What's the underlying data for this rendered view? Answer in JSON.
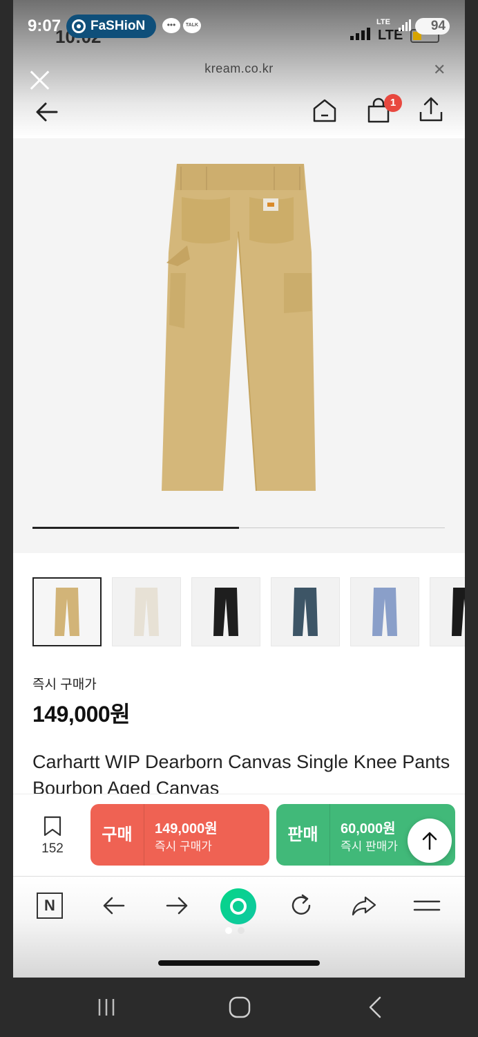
{
  "status_bar": {
    "time": "9:07",
    "ghost_time": "10:02",
    "app_pill_label": "FaSHioN",
    "talk_label": "TALK",
    "network": "LTE",
    "network_small": "LTE",
    "battery": "94"
  },
  "browser": {
    "url": "kream.co.kr",
    "cart_badge": "1"
  },
  "product": {
    "gallery_progress": 0.5,
    "thumbnail_colors": [
      "#d2b478",
      "#e7e1d5",
      "#1e1e1e",
      "#3d5566",
      "#8a9fc9",
      "#1a1a1a"
    ],
    "instant_buy_label": "즉시 구매가",
    "instant_buy_price": "149,000원",
    "name": "Carhartt WIP Dearborn Canvas Single Knee Pants Bourbon Aged Canvas"
  },
  "actions": {
    "bookmark_count": "152",
    "buy_tag": "구매",
    "buy_price": "149,000원",
    "buy_sub": "즉시 구매가",
    "sell_tag": "판매",
    "sell_price": "60,000원",
    "sell_sub": "즉시 판매가"
  },
  "toolbar": {
    "naver_label": "N"
  },
  "colors": {
    "buy": "#ef6253",
    "sell": "#41b979",
    "badge": "#e8483f",
    "accent_green": "#05d686"
  }
}
